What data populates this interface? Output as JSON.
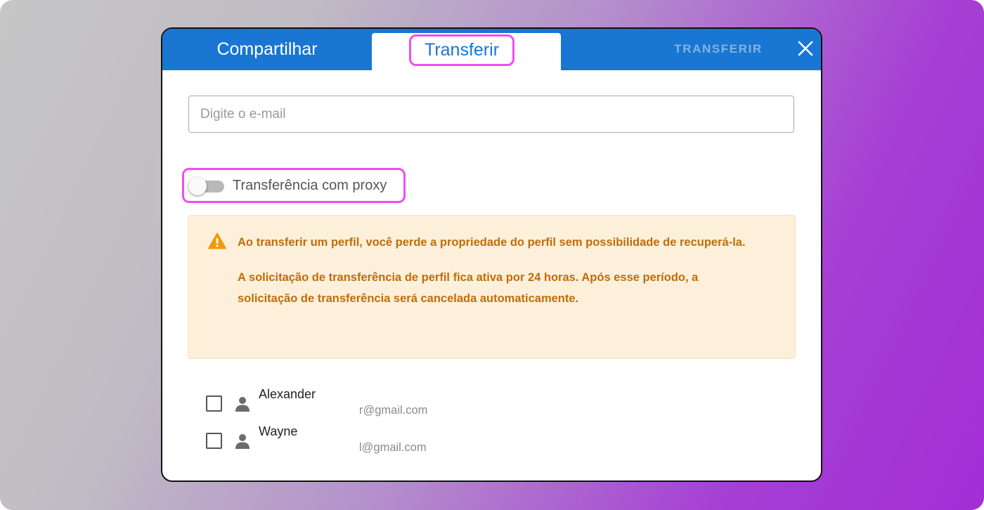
{
  "dialog": {
    "tabs": [
      {
        "label": "Compartilhar",
        "active": false
      },
      {
        "label": "Transferir",
        "active": true
      }
    ],
    "action_label": "TRANSFERIR",
    "close_icon": "close-icon"
  },
  "email_input": {
    "placeholder": "Digite o e-mail",
    "value": ""
  },
  "proxy_toggle": {
    "label": "Transferência com proxy",
    "enabled": false
  },
  "warning": {
    "icon": "warning-icon",
    "paragraphs": [
      "Ao transferir um perfil, você perde a propriedade do perfil sem possibilidade de recuperá-la.",
      "A solicitação de transferência de perfil fica ativa por 24 horas. Após esse período, a solicitação de transferência será cancelada automaticamente."
    ]
  },
  "users": [
    {
      "name": "Alexander",
      "email": "r@gmail.com",
      "checked": false,
      "icon": "person-icon"
    },
    {
      "name": "Wayne",
      "email": "l@gmail.com",
      "checked": false,
      "icon": "person-icon"
    }
  ],
  "colors": {
    "header_blue": "#1976d2",
    "highlight_pink": "#ee4fee",
    "warning_text": "#c06d0b",
    "warning_bg": "#fdf0da"
  }
}
